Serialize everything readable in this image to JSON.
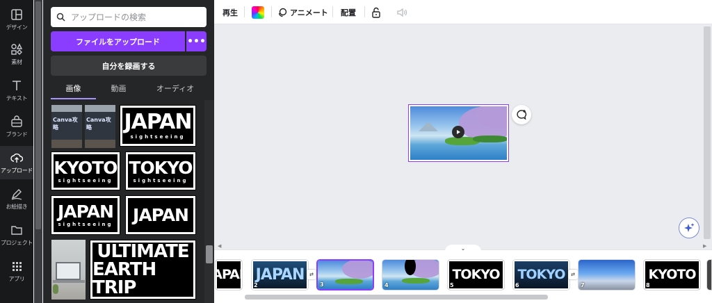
{
  "rail": {
    "items": [
      {
        "label": "デザイン",
        "icon": "layout-icon"
      },
      {
        "label": "素材",
        "icon": "shapes-icon"
      },
      {
        "label": "テキスト",
        "icon": "text-icon"
      },
      {
        "label": "ブランド",
        "icon": "brand-icon"
      },
      {
        "label": "アップロード",
        "icon": "cloud-upload-icon"
      },
      {
        "label": "お絵描き",
        "icon": "draw-icon"
      },
      {
        "label": "プロジェクト",
        "icon": "folder-icon"
      },
      {
        "label": "アプリ",
        "icon": "apps-grid-icon"
      }
    ],
    "active_index": 4
  },
  "panel": {
    "search_placeholder": "アップロードの検索",
    "upload_label": "ファイルをアップロード",
    "more_label": "•••",
    "record_label": "自分を録画する",
    "tabs": [
      "画像",
      "動画",
      "オーディオ"
    ],
    "active_tab": 0,
    "thumbs": {
      "canva_title": "Canva攻略",
      "logo_sub": "sightseeing",
      "japan": "JAPAN",
      "kyoto": "KYOTO",
      "tokyo": "TOKYO",
      "ultimate_line1": "ULTIMATE",
      "ultimate_line2": "EARTH TRIP"
    }
  },
  "toolbar": {
    "play_label": "再生",
    "animate_label": "アニメート",
    "arrange_label": "配置"
  },
  "timeline": {
    "toggle": "⌄",
    "items": [
      {
        "num": "",
        "kind": "logo",
        "text": "JAPAN"
      },
      {
        "num": "2",
        "kind": "logo-photo",
        "text": "JAPAN"
      },
      {
        "num": "3",
        "kind": "scene"
      },
      {
        "num": "4",
        "kind": "scene"
      },
      {
        "num": "5",
        "kind": "logo",
        "text": "TOKYO"
      },
      {
        "num": "6",
        "kind": "logo-photo",
        "text": "TOKYO"
      },
      {
        "num": "7",
        "kind": "city"
      },
      {
        "num": "8",
        "kind": "logo",
        "text": "KYOTO"
      }
    ]
  },
  "colors": {
    "accent": "#8b3dff",
    "rail_bg": "#18191b",
    "panel_bg": "#252627"
  }
}
